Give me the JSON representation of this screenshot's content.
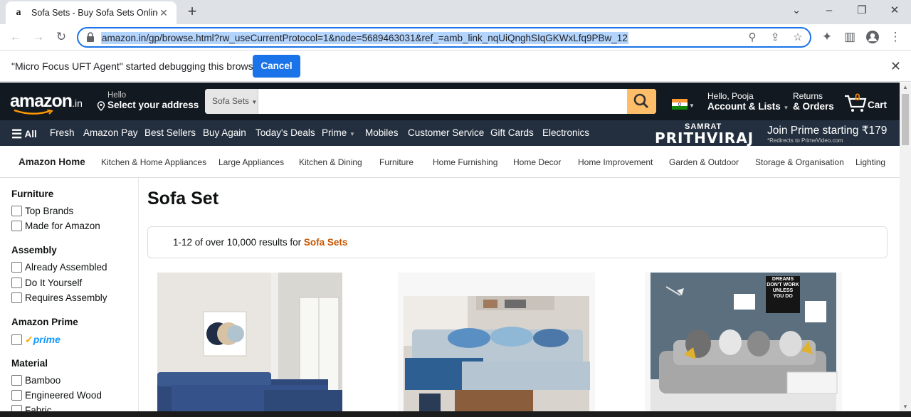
{
  "browser": {
    "tab_title": "Sofa Sets - Buy Sofa Sets Online",
    "tab_favicon": "a",
    "url": "amazon.in/gp/browse.html?rw_useCurrentProtocol=1&node=5689463031&ref_=amb_link_nqUiQnghSIqGKWxLfq9PBw_12",
    "debug_message": "\"Micro Focus UFT Agent\" started debugging this browser",
    "debug_cancel": "Cancel"
  },
  "header": {
    "logo": "amazon",
    "logo_suffix": ".in",
    "hello": "Hello",
    "select_address": "Select your address",
    "search_category": "Sofa Sets",
    "account_line1": "Hello, Pooja",
    "account_line2": "Account & Lists",
    "returns_line1": "Returns",
    "returns_line2": "& Orders",
    "cart_count": "0",
    "cart_label": "Cart"
  },
  "nav_belt": {
    "all": "All",
    "items": [
      "Fresh",
      "Amazon Pay",
      "Best Sellers",
      "Buy Again",
      "Today's Deals",
      "Prime",
      "Mobiles",
      "Customer Service",
      "Gift Cards",
      "Electronics"
    ],
    "promo_samrat": "SAMRAT",
    "promo_title": "PRITHVIRAJ",
    "promo_text": "Join Prime starting ₹179",
    "promo_sub": "*Redirects to PrimeVideo.com"
  },
  "subnav": {
    "home": "Amazon Home",
    "items": [
      "Kitchen & Home Appliances",
      "Large Appliances",
      "Kitchen & Dining",
      "Furniture",
      "Home Furnishing",
      "Home Decor",
      "Home Improvement",
      "Garden & Outdoor",
      "Storage & Organisation",
      "Lighting"
    ]
  },
  "filters": {
    "furniture_head": "Furniture",
    "furniture": [
      "Top Brands",
      "Made for Amazon"
    ],
    "assembly_head": "Assembly",
    "assembly": [
      "Already Assembled",
      "Do It Yourself",
      "Requires Assembly"
    ],
    "prime_head": "Amazon Prime",
    "prime_label": "prime",
    "material_head": "Material",
    "material": [
      "Bamboo",
      "Engineered Wood",
      "Fabric"
    ]
  },
  "results": {
    "title": "Sofa Set",
    "count_text": "1-12 of over 10,000 results for ",
    "query": "Sofa Sets"
  },
  "wall_sign": [
    "DREAMS",
    "DON'T WORK",
    "UNLESS",
    "YOU DO"
  ],
  "colors": {
    "amazon_dark": "#131921",
    "amazon_belt": "#232f3e",
    "search_button": "#febd69",
    "link_orange": "#c45500",
    "chrome_blue": "#1a73e8"
  }
}
